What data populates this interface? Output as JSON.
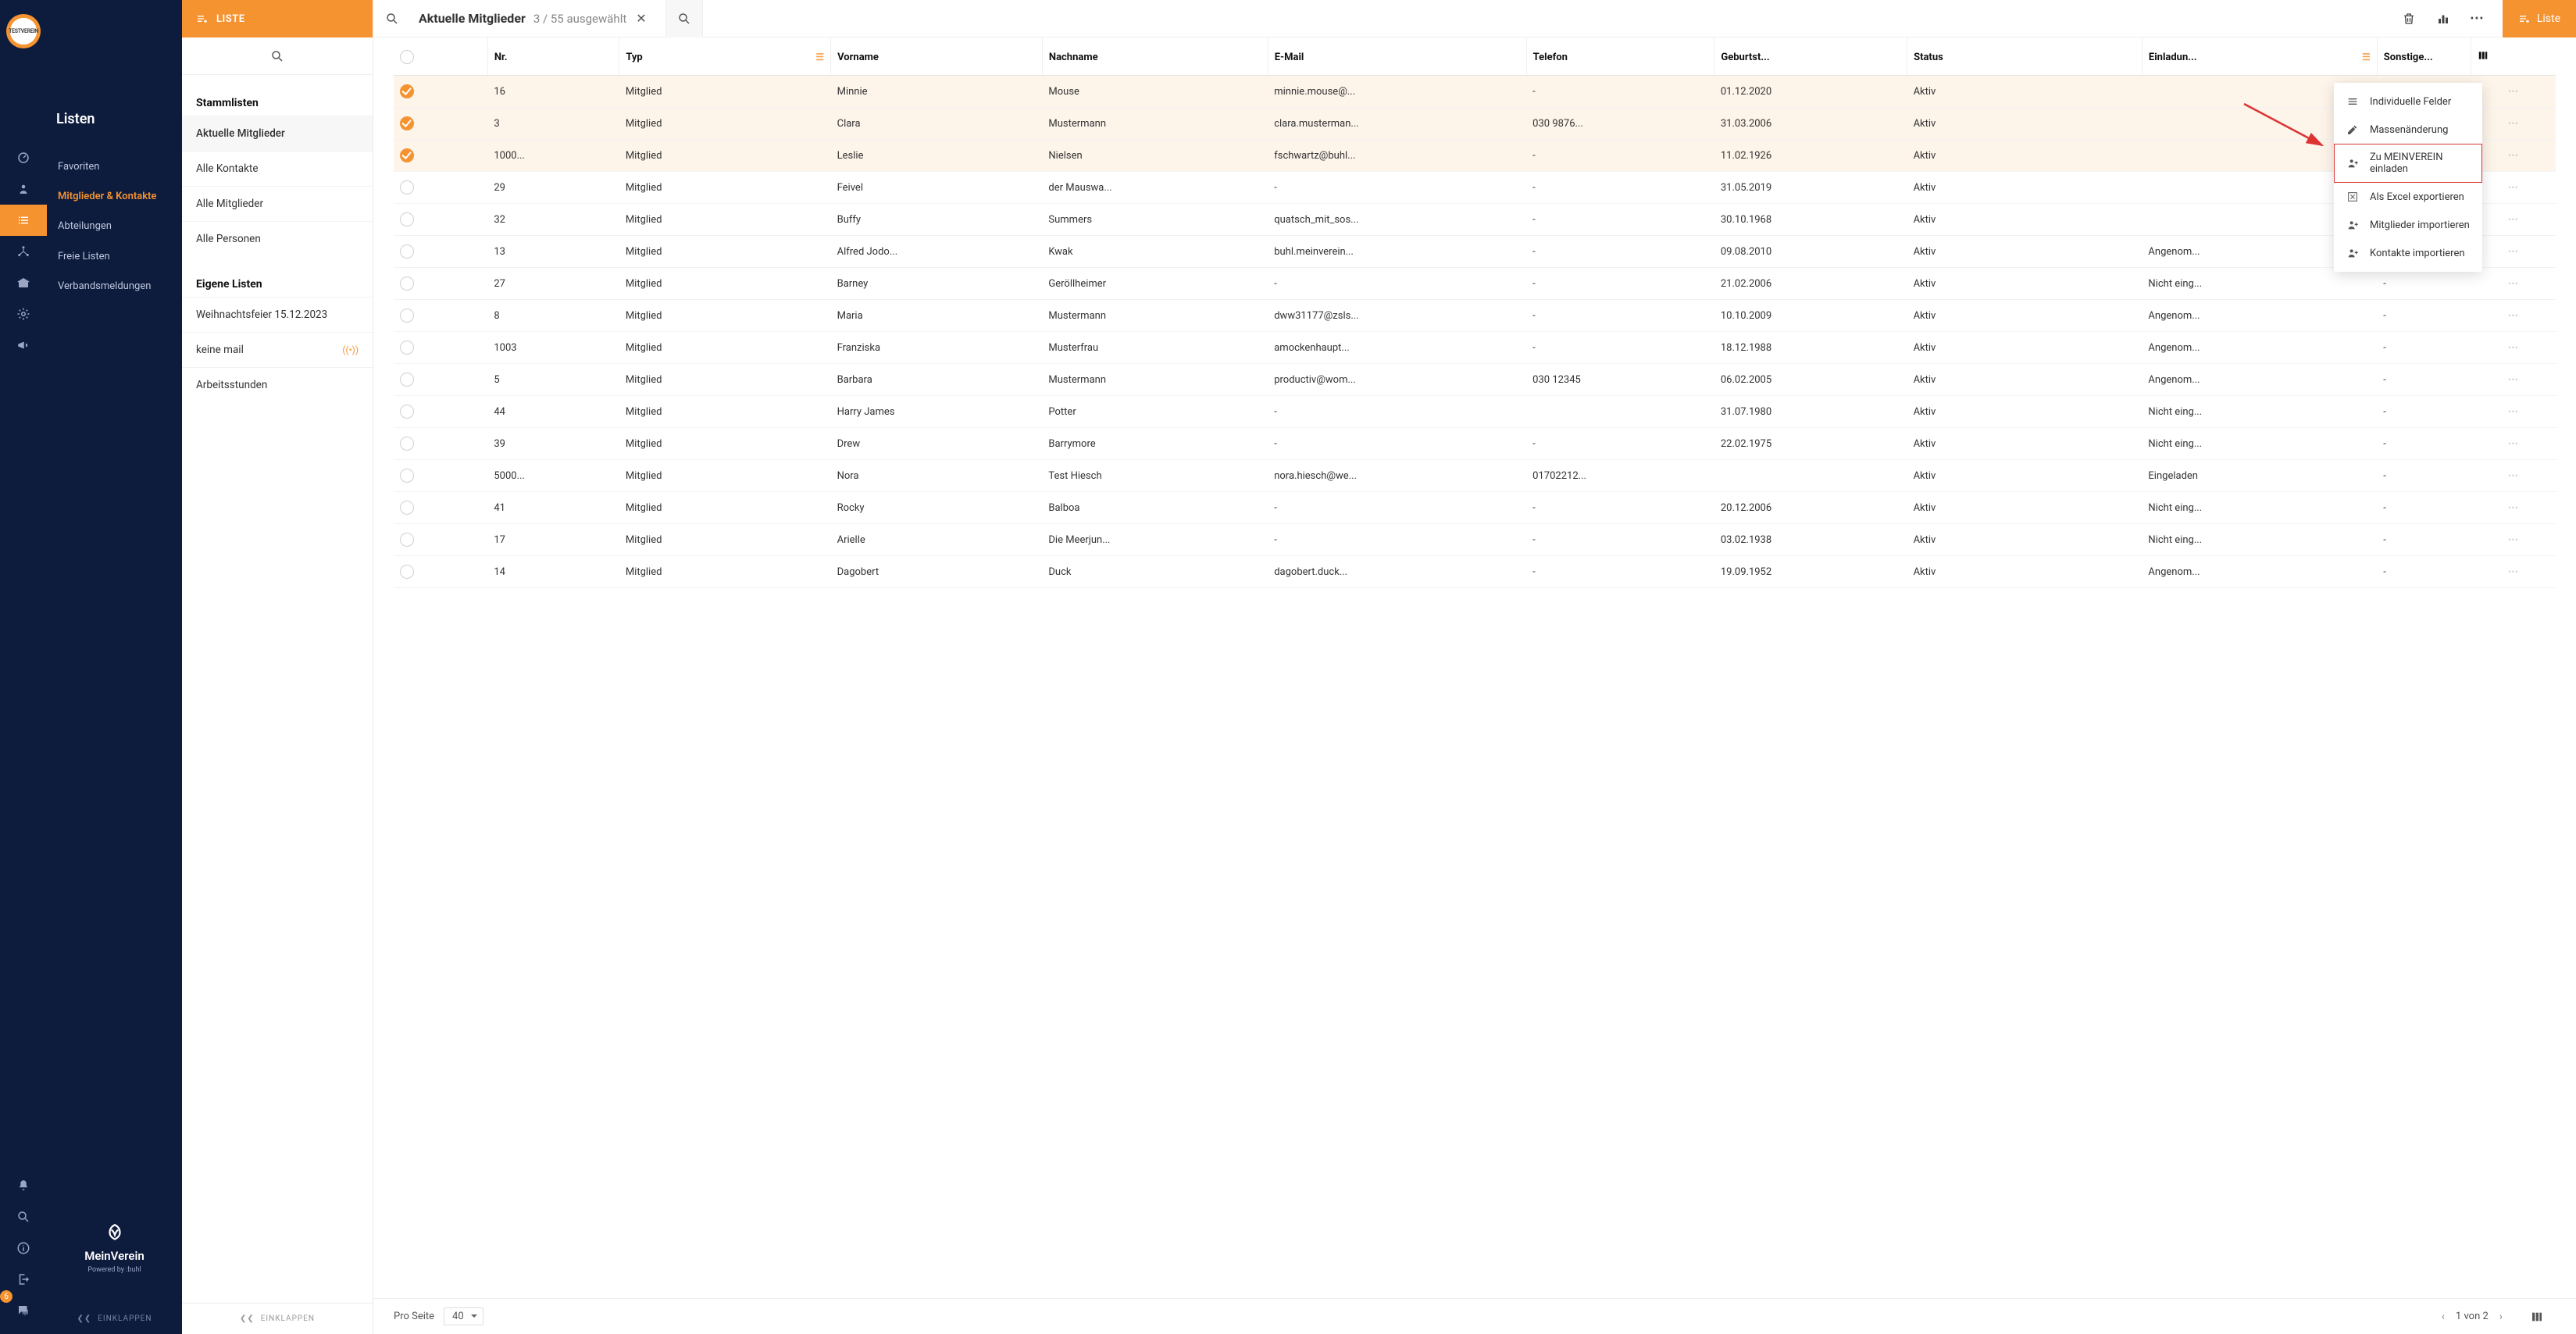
{
  "logo_text": "TESTVEREIN",
  "nav": {
    "title": "Listen",
    "items": [
      "Favoriten",
      "Mitglieder & Kontakte",
      "Abteilungen",
      "Freie Listen",
      "Verbandsmeldungen"
    ],
    "active_index": 1,
    "brand_name": "MeinVerein",
    "brand_sub": "Powered by  :buhl",
    "collapse": "EINKLAPPEN",
    "badge_count": "6"
  },
  "listpanel": {
    "head": "LISTE",
    "sections": [
      {
        "title": "Stammlisten",
        "items": [
          "Aktuelle Mitglieder",
          "Alle Kontakte",
          "Alle Mitglieder",
          "Alle Personen"
        ],
        "selected": 0
      },
      {
        "title": "Eigene Listen",
        "items": [
          "Weihnachtsfeier 15.12.2023",
          "keine mail",
          "Arbeitsstunden"
        ],
        "live_index": 1
      }
    ],
    "collapse": "EINKLAPPEN"
  },
  "topbar": {
    "title": "Aktuelle Mitglieder",
    "sub": "3 / 55 ausgewählt",
    "button": "Liste"
  },
  "dropdown": {
    "items": [
      {
        "icon": "list",
        "label": "Individuelle Felder"
      },
      {
        "icon": "pencil",
        "label": "Massenänderung"
      },
      {
        "icon": "personplus",
        "label": "Zu MEINVEREIN einladen",
        "highlight": true
      },
      {
        "icon": "excel",
        "label": "Als Excel exportieren"
      },
      {
        "icon": "personplus",
        "label": "Mitglieder importieren"
      },
      {
        "icon": "personplus",
        "label": "Kontakte importieren"
      }
    ]
  },
  "table": {
    "headers": [
      "Nr.",
      "Typ",
      "Vorname",
      "Nachname",
      "E-Mail",
      "Telefon",
      "Geburtst...",
      "Status",
      "Einladun...",
      "Sonstige..."
    ],
    "sort_cols": [
      1,
      8
    ],
    "rows": [
      {
        "sel": true,
        "nr": "16",
        "typ": "Mitglied",
        "vor": "Minnie",
        "nach": "Mouse",
        "email": "minnie.mouse@...",
        "tel": "-",
        "geb": "01.12.2020",
        "status": "Aktiv",
        "einl": "",
        "sonst": ""
      },
      {
        "sel": true,
        "nr": "3",
        "typ": "Mitglied",
        "vor": "Clara",
        "nach": "Mustermann",
        "email": "clara.musterman...",
        "tel": "030 9876...",
        "geb": "31.03.2006",
        "status": "Aktiv",
        "einl": "",
        "sonst": ""
      },
      {
        "sel": true,
        "nr": "1000...",
        "typ": "Mitglied",
        "vor": "Leslie",
        "nach": "Nielsen",
        "email": "fschwartz@buhl...",
        "tel": "-",
        "geb": "11.02.1926",
        "status": "Aktiv",
        "einl": "",
        "sonst": ""
      },
      {
        "sel": false,
        "nr": "29",
        "typ": "Mitglied",
        "vor": "Feivel",
        "nach": "der Mauswa...",
        "email": "-",
        "tel": "-",
        "geb": "31.05.2019",
        "status": "Aktiv",
        "einl": "",
        "sonst": ""
      },
      {
        "sel": false,
        "nr": "32",
        "typ": "Mitglied",
        "vor": "Buffy",
        "nach": "Summers",
        "email": "quatsch_mit_sos...",
        "tel": "-",
        "geb": "30.10.1968",
        "status": "Aktiv",
        "einl": "",
        "sonst": ""
      },
      {
        "sel": false,
        "nr": "13",
        "typ": "Mitglied",
        "vor": "Alfred Jodo...",
        "nach": "Kwak",
        "email": "buhl.meinverein...",
        "tel": "-",
        "geb": "09.08.2010",
        "status": "Aktiv",
        "einl": "Angenom...",
        "sonst": "-"
      },
      {
        "sel": false,
        "nr": "27",
        "typ": "Mitglied",
        "vor": "Barney",
        "nach": "Geröllheimer",
        "email": "-",
        "tel": "-",
        "geb": "21.02.2006",
        "status": "Aktiv",
        "einl": "Nicht eing...",
        "sonst": "-"
      },
      {
        "sel": false,
        "nr": "8",
        "typ": "Mitglied",
        "vor": "Maria",
        "nach": "Mustermann",
        "email": "dww31177@zsls...",
        "tel": "-",
        "geb": "10.10.2009",
        "status": "Aktiv",
        "einl": "Angenom...",
        "sonst": "-"
      },
      {
        "sel": false,
        "nr": "1003",
        "typ": "Mitglied",
        "vor": "Franziska",
        "nach": "Musterfrau",
        "email": "amockenhaupt...",
        "tel": "-",
        "geb": "18.12.1988",
        "status": "Aktiv",
        "einl": "Angenom...",
        "sonst": "-"
      },
      {
        "sel": false,
        "nr": "5",
        "typ": "Mitglied",
        "vor": "Barbara",
        "nach": "Mustermann",
        "email": "productiv@wom...",
        "tel": "030 12345",
        "geb": "06.02.2005",
        "status": "Aktiv",
        "einl": "Angenom...",
        "sonst": "-"
      },
      {
        "sel": false,
        "nr": "44",
        "typ": "Mitglied",
        "vor": "Harry James",
        "nach": "Potter",
        "email": "-",
        "tel": "",
        "geb": "31.07.1980",
        "status": "Aktiv",
        "einl": "Nicht eing...",
        "sonst": "-"
      },
      {
        "sel": false,
        "nr": "39",
        "typ": "Mitglied",
        "vor": "Drew",
        "nach": "Barrymore",
        "email": "-",
        "tel": "-",
        "geb": "22.02.1975",
        "status": "Aktiv",
        "einl": "Nicht eing...",
        "sonst": "-"
      },
      {
        "sel": false,
        "nr": "5000...",
        "typ": "Mitglied",
        "vor": "Nora",
        "nach": "Test Hiesch",
        "email": "nora.hiesch@we...",
        "tel": "01702212...",
        "geb": "",
        "status": "Aktiv",
        "einl": "Eingeladen",
        "sonst": "-"
      },
      {
        "sel": false,
        "nr": "41",
        "typ": "Mitglied",
        "vor": "Rocky",
        "nach": "Balboa",
        "email": "-",
        "tel": "-",
        "geb": "20.12.2006",
        "status": "Aktiv",
        "einl": "Nicht eing...",
        "sonst": "-"
      },
      {
        "sel": false,
        "nr": "17",
        "typ": "Mitglied",
        "vor": "Arielle",
        "nach": "Die Meerjun...",
        "email": "-",
        "tel": "-",
        "geb": "03.02.1938",
        "status": "Aktiv",
        "einl": "Nicht eing...",
        "sonst": "-"
      },
      {
        "sel": false,
        "nr": "14",
        "typ": "Mitglied",
        "vor": "Dagobert",
        "nach": "Duck",
        "email": "dagobert.duck...",
        "tel": "-",
        "geb": "19.09.1952",
        "status": "Aktiv",
        "einl": "Angenom...",
        "sonst": "-"
      }
    ]
  },
  "footer": {
    "per_page_label": "Pro Seite",
    "per_page_value": "40",
    "pager_text": "1 von 2"
  }
}
